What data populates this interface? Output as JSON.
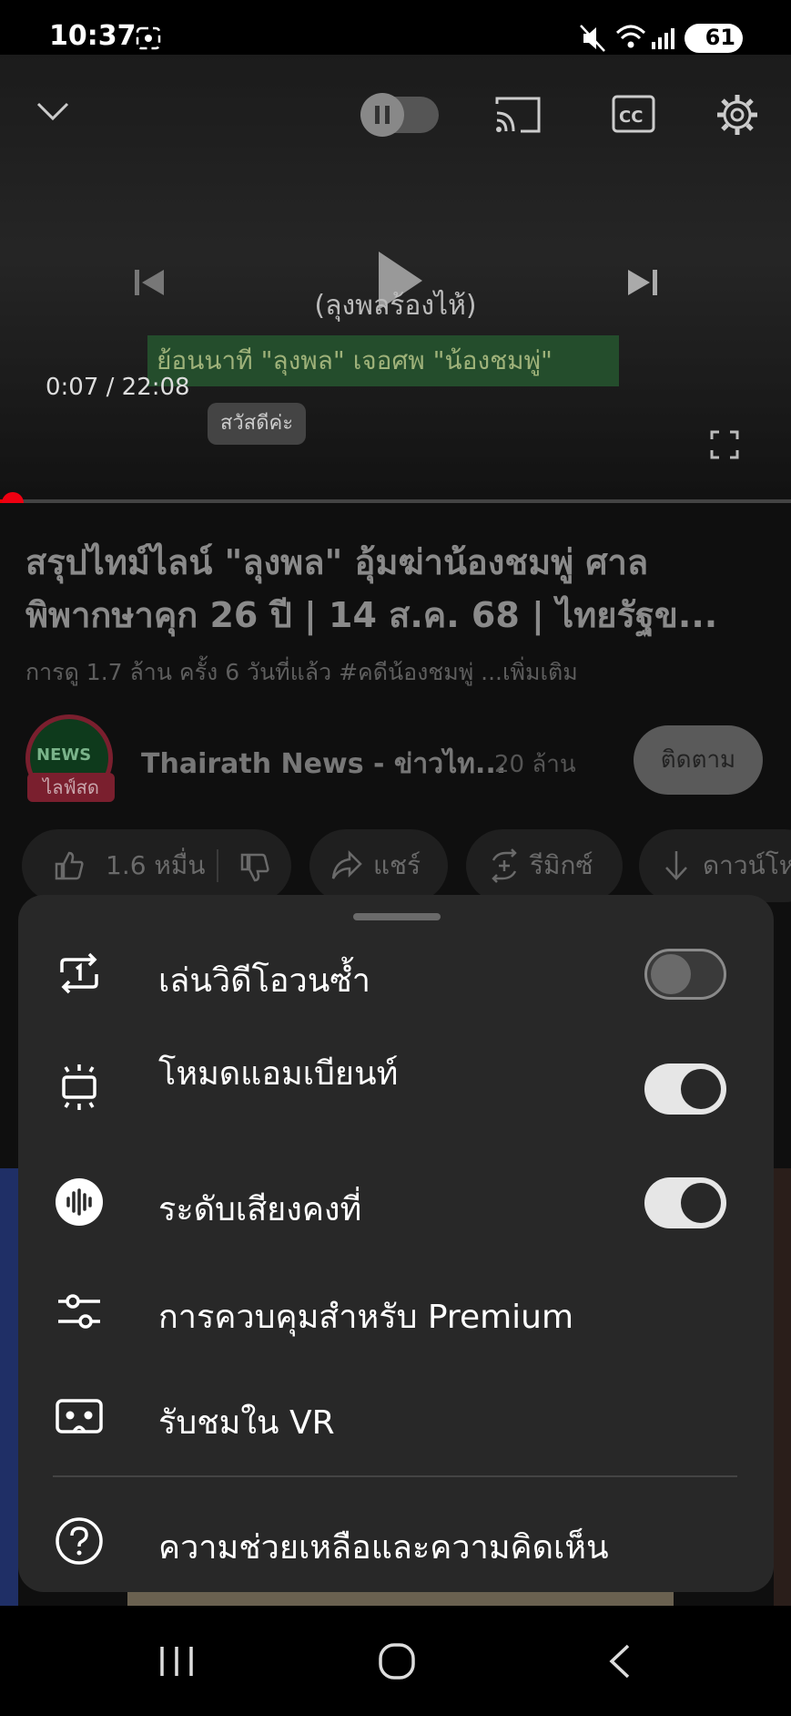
{
  "status_bar": {
    "time": "10:37",
    "battery": "61"
  },
  "video": {
    "caption": "(ลุงพลร้องไห้)",
    "banner_text": "ย้อนนาที \"ลุงพล\" เจอศพ \"น้องชมพู่\"",
    "timecode": "0:07 / 22:08",
    "greeting": "สวัสดีค่ะ",
    "progress": 0.005
  },
  "video_info": {
    "title": "สรุปไทม์ไลน์ \"ลุงพล\" อุ้มฆ่าน้องชมพู่ ศาลพิพากษาคุก 26 ปี  | 14 ส.ค. 68 | ไทยรัฐข...",
    "meta": "การดู 1.7 ล้าน ครั้ง  6 วันที่แล้ว  #คดีน้องชมพู่  ...เพิ่มเติม"
  },
  "channel": {
    "avatar_text": "NEWS",
    "live_badge": "ไลฟ์สด",
    "name": "Thairath News - ข่าวไท...",
    "subscribers": "20 ล้าน",
    "subscribe_label": "ติดตาม"
  },
  "actions": {
    "like_count": "1.6 หมื่น",
    "share_label": "แชร์",
    "remix_label": "รีมิกซ์",
    "download_label": "ดาวน์โห"
  },
  "sheet": {
    "items": [
      {
        "label": "เล่นวิดีโอวนซ้ำ",
        "icon": "repeat-one-icon",
        "toggle": false
      },
      {
        "label": "โหมดแอมเบียนท์",
        "icon": "ambient-mode-icon",
        "toggle": true
      },
      {
        "label": "ระดับเสียงคงที่",
        "icon": "stable-volume-icon",
        "toggle": true
      },
      {
        "label": "การควบคุมสำหรับ Premium",
        "icon": "sliders-icon"
      },
      {
        "label": "รับชมใน VR",
        "icon": "vr-headset-icon"
      },
      {
        "label": "ความช่วยเหลือและความคิดเห็น",
        "icon": "help-icon"
      }
    ]
  },
  "colors": {
    "accent_red": "#ee0000",
    "sheet_bg": "#282828"
  }
}
